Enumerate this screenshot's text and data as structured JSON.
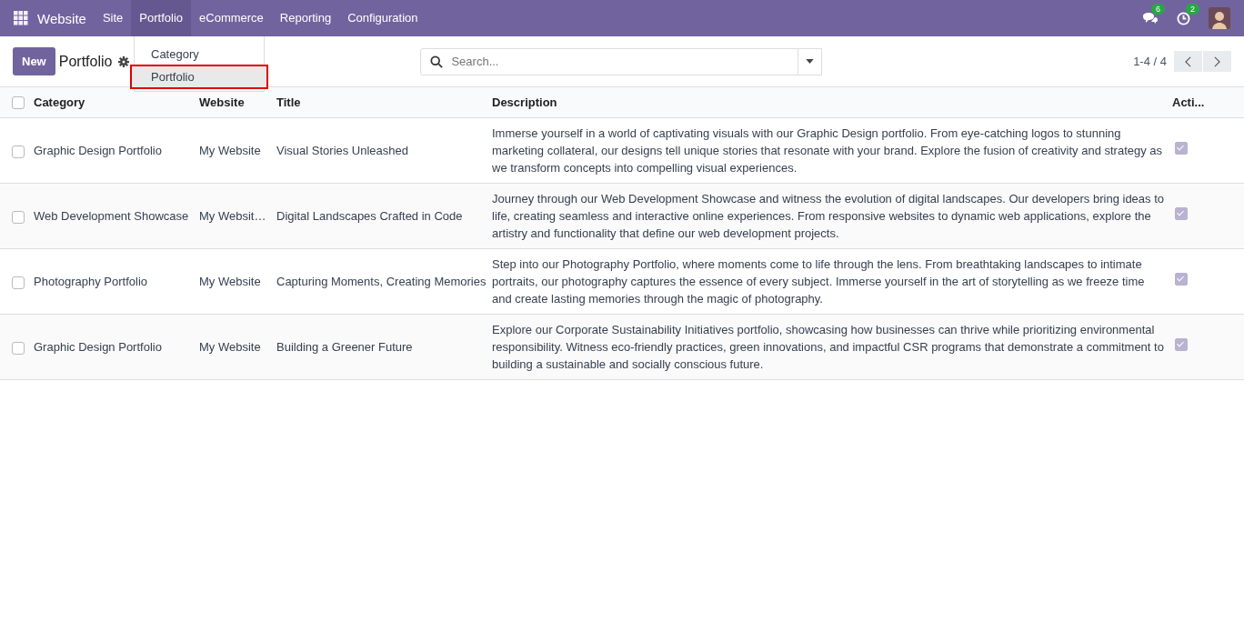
{
  "navbar": {
    "app_name": "Website",
    "menu": [
      {
        "label": "Site",
        "selected": false
      },
      {
        "label": "Portfolio",
        "selected": true
      },
      {
        "label": "eCommerce",
        "selected": false
      },
      {
        "label": "Reporting",
        "selected": false
      },
      {
        "label": "Configuration",
        "selected": false
      }
    ],
    "messages_badge": "6",
    "activities_badge": "2"
  },
  "dropdown": {
    "items": [
      {
        "label": "Category",
        "selected": false
      },
      {
        "label": "Portfolio",
        "selected": true
      }
    ]
  },
  "control_panel": {
    "new_button": "New",
    "title": "Portfolio",
    "search": {
      "placeholder": "Search..."
    },
    "pager": "1-4 / 4"
  },
  "table": {
    "select_all": {
      "checked": false
    },
    "columns": [
      "Category",
      "Website",
      "Title",
      "Description",
      "Acti..."
    ],
    "rows": [
      {
        "selected": false,
        "category": "Graphic Design Portfolio",
        "website": "My Website",
        "title": "Visual Stories Unleashed",
        "description": "Immerse yourself in a world of captivating visuals with our Graphic Design portfolio. From eye-catching logos to stunning marketing collateral, our designs tell unique stories that resonate with your brand. Explore the fusion of creativity and strategy as we transform concepts into compelling visual experiences.",
        "active": true
      },
      {
        "selected": false,
        "category": "Web Development Showcase",
        "website": "My Websit…",
        "title": "Digital Landscapes Crafted in Code",
        "description": "Journey through our Web Development Showcase and witness the evolution of digital landscapes. Our developers bring ideas to life, creating seamless and interactive online experiences. From responsive websites to dynamic web applications, explore the artistry and functionality that define our web development projects.",
        "active": true
      },
      {
        "selected": false,
        "category": "Photography Portfolio",
        "website": "My Website",
        "title": "Capturing Moments, Creating Memories",
        "description": "Step into our Photography Portfolio, where moments come to life through the lens. From breathtaking landscapes to intimate portraits, our photography captures the essence of every subject. Immerse yourself in the art of storytelling as we freeze time and create lasting memories through the magic of photography.",
        "active": true
      },
      {
        "selected": false,
        "category": "Graphic Design Portfolio",
        "website": "My Website",
        "title": "Building a Greener Future",
        "description": "Explore our Corporate Sustainability Initiatives portfolio, showcasing how businesses can thrive while prioritizing environmental responsibility. Witness eco-friendly practices, green innovations, and impactful CSR programs that demonstrate a commitment to building a sustainable and socially conscious future.",
        "active": true
      }
    ]
  }
}
